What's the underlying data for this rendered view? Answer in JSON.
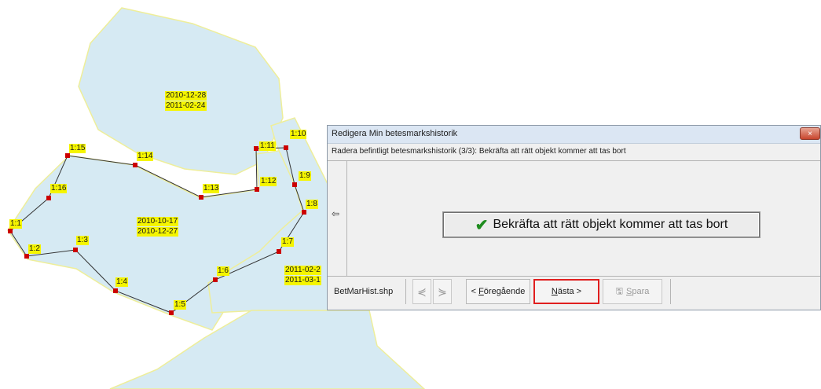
{
  "map": {
    "area_labels": [
      {
        "id": "north",
        "lines": [
          "2010-12-28",
          "2011-02-24"
        ]
      },
      {
        "id": "west",
        "lines": [
          "2010-10-17",
          "2010-12-27"
        ]
      },
      {
        "id": "east",
        "lines": [
          "2011-02-2",
          "2011-03-1"
        ]
      }
    ],
    "vertex_labels": [
      "1:1",
      "1:2",
      "1:3",
      "1:4",
      "1:5",
      "1:6",
      "1:7",
      "1:8",
      "1:9",
      "1:10",
      "1:11",
      "1:12",
      "1:13",
      "1:14",
      "1:15",
      "1:16"
    ],
    "colors": {
      "polygon_fill": "#d6eaf3",
      "polygon_border": "#f0f0a0",
      "vertex": "#cc0000",
      "label_bg": "#f5f500"
    }
  },
  "dialog": {
    "title": "Redigera Min betesmarkshistorik",
    "close_icon": "×",
    "subtitle": "Radera befintligt betesmarkshistorik (3/3): Bekräfta att rätt objekt kommer att tas bort",
    "side_icon": "⇦",
    "confirm_check_icon": "✔",
    "confirm_label": "Bekräfta att rätt objekt kommer att tas bort",
    "bottom": {
      "file_name": "BetMarHist.shp",
      "prev_icon": "⋞",
      "next_icon": "⋟",
      "prev_label_prefix": "< ",
      "prev_label_accel": "F",
      "prev_label_rest": "öregående",
      "next_label_accel": "N",
      "next_label_rest": "ästa >",
      "save_icon": "🖫",
      "save_label_accel": "S",
      "save_label_rest": "para"
    }
  }
}
